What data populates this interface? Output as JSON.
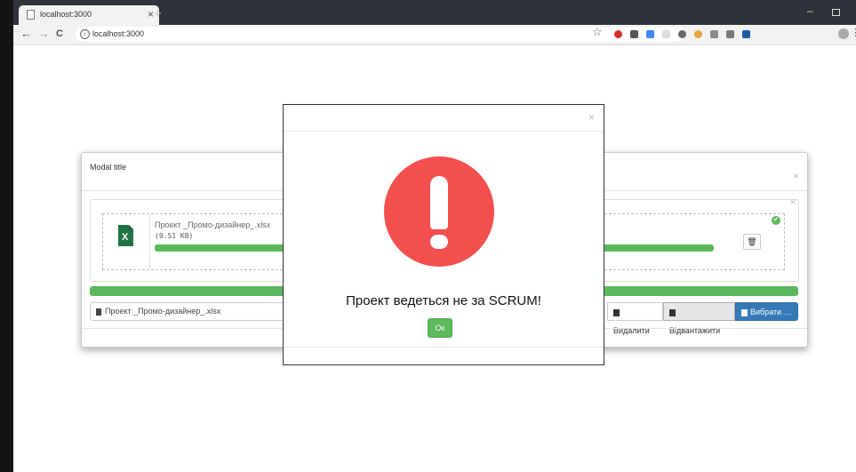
{
  "browser": {
    "tab_title": "localhost:3000",
    "tab_close": "×",
    "new_tab": "+",
    "minimize": "–",
    "back": "←",
    "forward": "→",
    "reload": "C",
    "info": "i",
    "url": "localhost:3000",
    "bookmark_star": "☆",
    "menu": "⋮"
  },
  "modal": {
    "title": "Modal title",
    "close": "×",
    "dropzone_close": "×",
    "file": {
      "name": "Проект _Промо-дизайнер_.xlsx",
      "size": "(9.51 KB)",
      "progress": 1.0,
      "icon_label": "X",
      "delete_icon": "🗑",
      "status_icon": "✔"
    },
    "total_progress": 1.0,
    "caption": "Проект _Промо-дизайнер_.xlsx",
    "buttons": {
      "remove": "Видалити",
      "upload": "Відвантажити",
      "browse": "Вибрати …"
    }
  },
  "alert": {
    "close": "×",
    "message": "Проект ведеться не за SCRUM!",
    "ok_label": "Ок",
    "icon_color": "#f44f4f"
  },
  "colors": {
    "success": "#5cb85c",
    "primary": "#337ab7",
    "excel": "#217346"
  }
}
